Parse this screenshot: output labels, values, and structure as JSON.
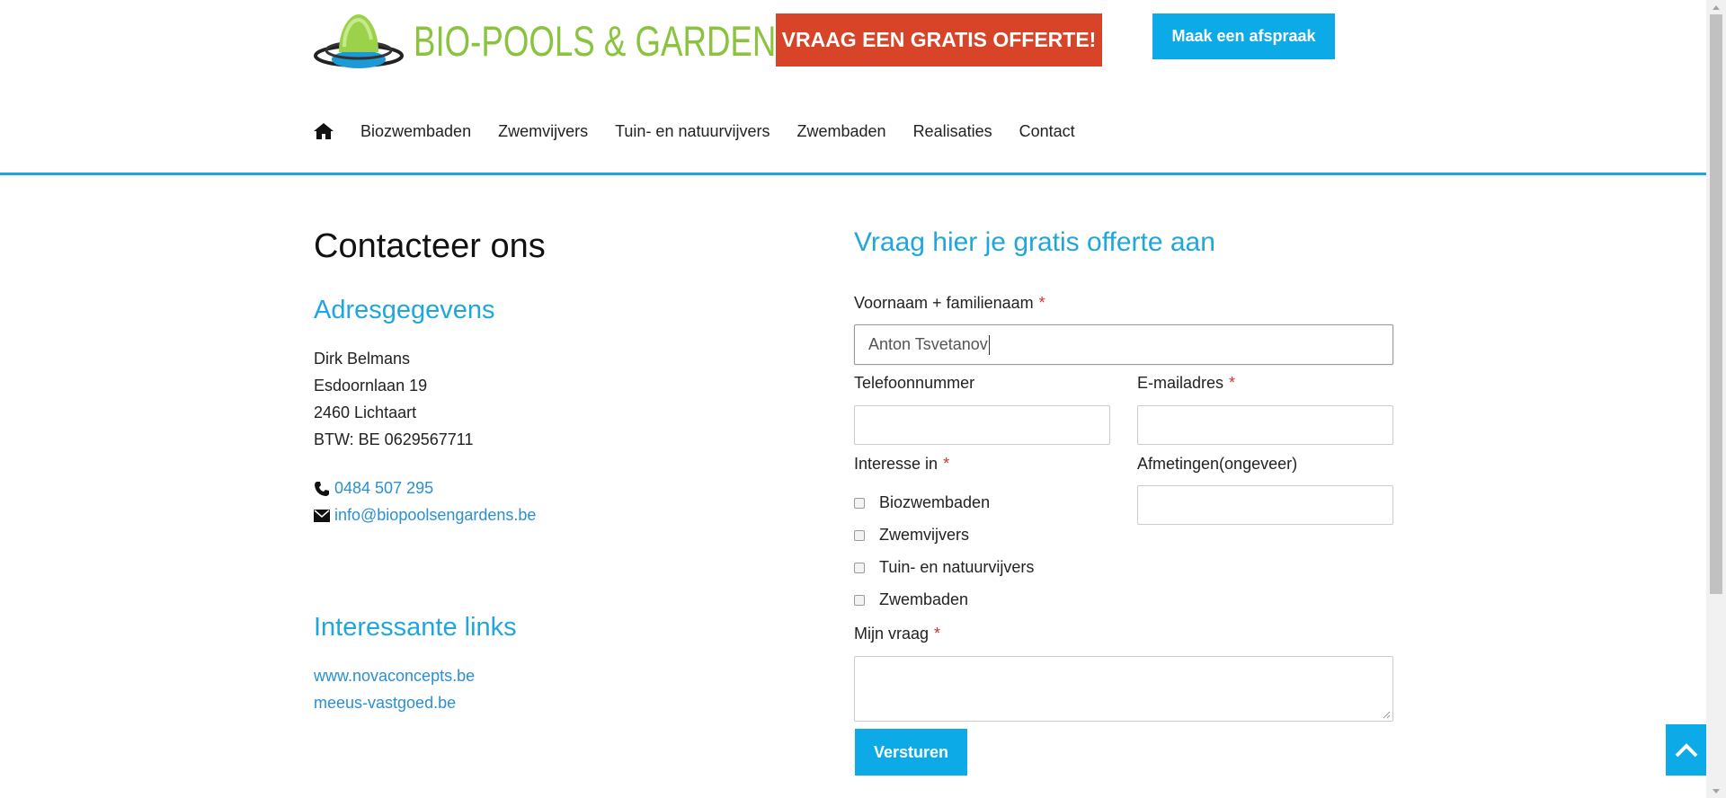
{
  "header": {
    "logo_text": "BIO-POOLS & GARDENS",
    "offerte_button": "VRAAG EEN GRATIS OFFERTE!",
    "afspraak_button": "Maak een afspraak"
  },
  "nav": {
    "items": [
      "Biozwembaden",
      "Zwemvijvers",
      "Tuin- en natuurvijvers",
      "Zwembaden",
      "Realisaties",
      "Contact"
    ]
  },
  "left": {
    "title": "Contacteer ons",
    "address_heading": "Adresgegevens",
    "address_lines": [
      "Dirk Belmans",
      "Esdoornlaan 19",
      "2460 Lichtaart",
      "BTW: BE 0629567711"
    ],
    "phone": "0484 507 295",
    "email": "info@biopoolsengardens.be",
    "links_heading": "Interessante links",
    "links": [
      "www.novaconcepts.be",
      "meeus-vastgoed.be"
    ]
  },
  "form": {
    "title": "Vraag hier je gratis offerte aan",
    "name_label": "Voornaam + familienaam",
    "name_value": "Anton Tsvetanov",
    "phone_label": "Telefoonnummer",
    "email_label": "E-mailadres",
    "interest_label": "Interesse in",
    "interest_options": [
      "Biozwembaden",
      "Zwemvijvers",
      "Tuin- en natuurvijvers",
      "Zwembaden"
    ],
    "size_label": "Afmetingen(ongeveer)",
    "question_label": "Mijn vraag",
    "required_mark": "*",
    "submit": "Versturen"
  },
  "colors": {
    "accent_blue": "#0cabe7",
    "heading_blue": "#1fa7dd",
    "brand_green": "#8ac43f",
    "offer_red": "#d84427"
  },
  "icons": {
    "home": "home-icon",
    "phone": "phone-icon",
    "email": "envelope-icon",
    "back_to_top": "chevron-up-icon"
  }
}
